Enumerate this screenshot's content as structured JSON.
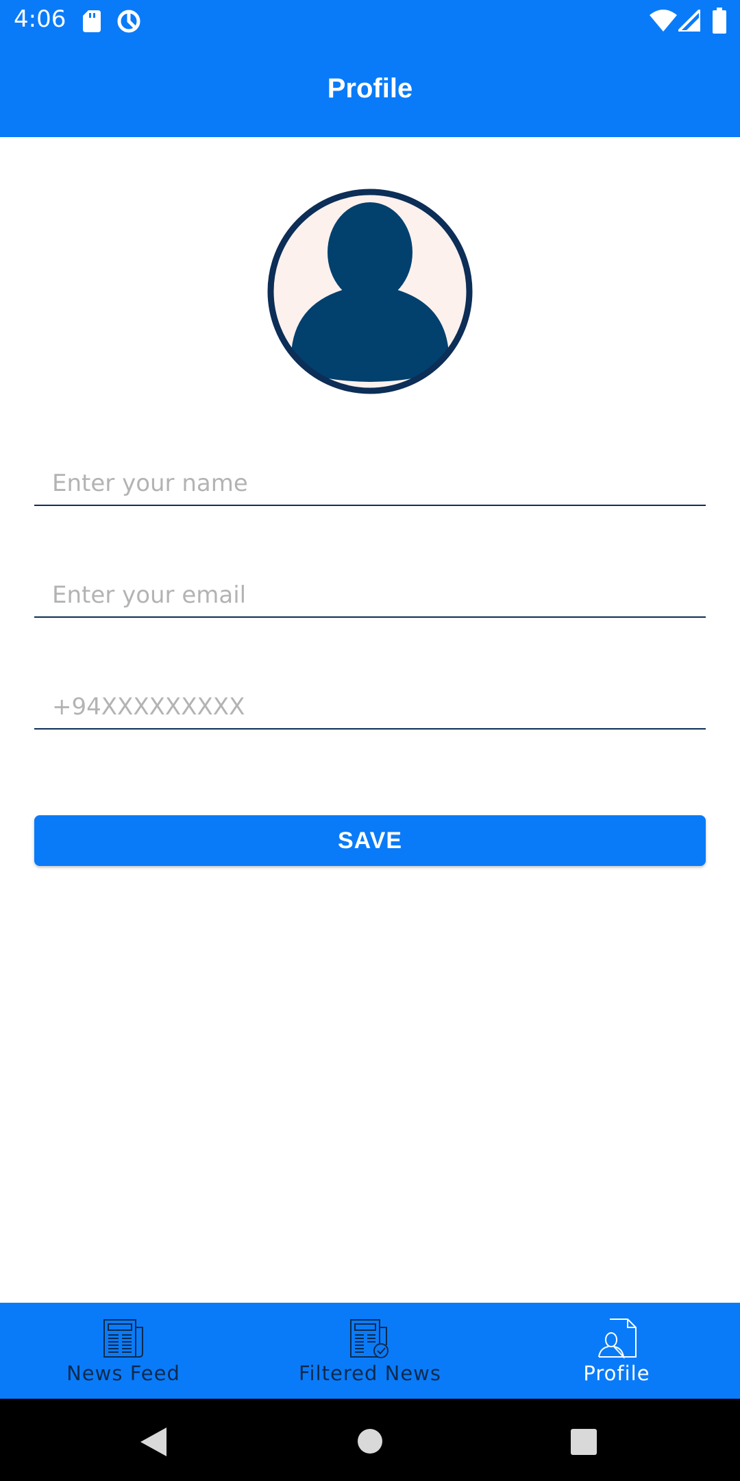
{
  "status_bar": {
    "time": "4:06",
    "icons": [
      "sd-card-icon",
      "data-saver-icon",
      "wifi-icon",
      "signal-icon",
      "battery-icon"
    ]
  },
  "header": {
    "title": "Profile"
  },
  "avatar": {
    "icon": "user-avatar-icon"
  },
  "form": {
    "name_placeholder": "Enter your name",
    "name_value": "",
    "email_placeholder": "Enter your email",
    "email_value": "",
    "phone_placeholder": "+94XXXXXXXXX",
    "phone_value": ""
  },
  "save_button": {
    "label": "SAVE"
  },
  "bottom_nav": {
    "items": [
      {
        "label": "News Feed",
        "icon": "newspaper-icon",
        "active": false
      },
      {
        "label": "Filtered News",
        "icon": "filtered-news-icon",
        "active": false
      },
      {
        "label": "Profile",
        "icon": "profile-document-icon",
        "active": true
      }
    ]
  },
  "colors": {
    "primary": "#0a7bf8",
    "dark_navy": "#0c2e57",
    "avatar_bg": "#fcf1ed",
    "avatar_fill": "#02406e"
  }
}
